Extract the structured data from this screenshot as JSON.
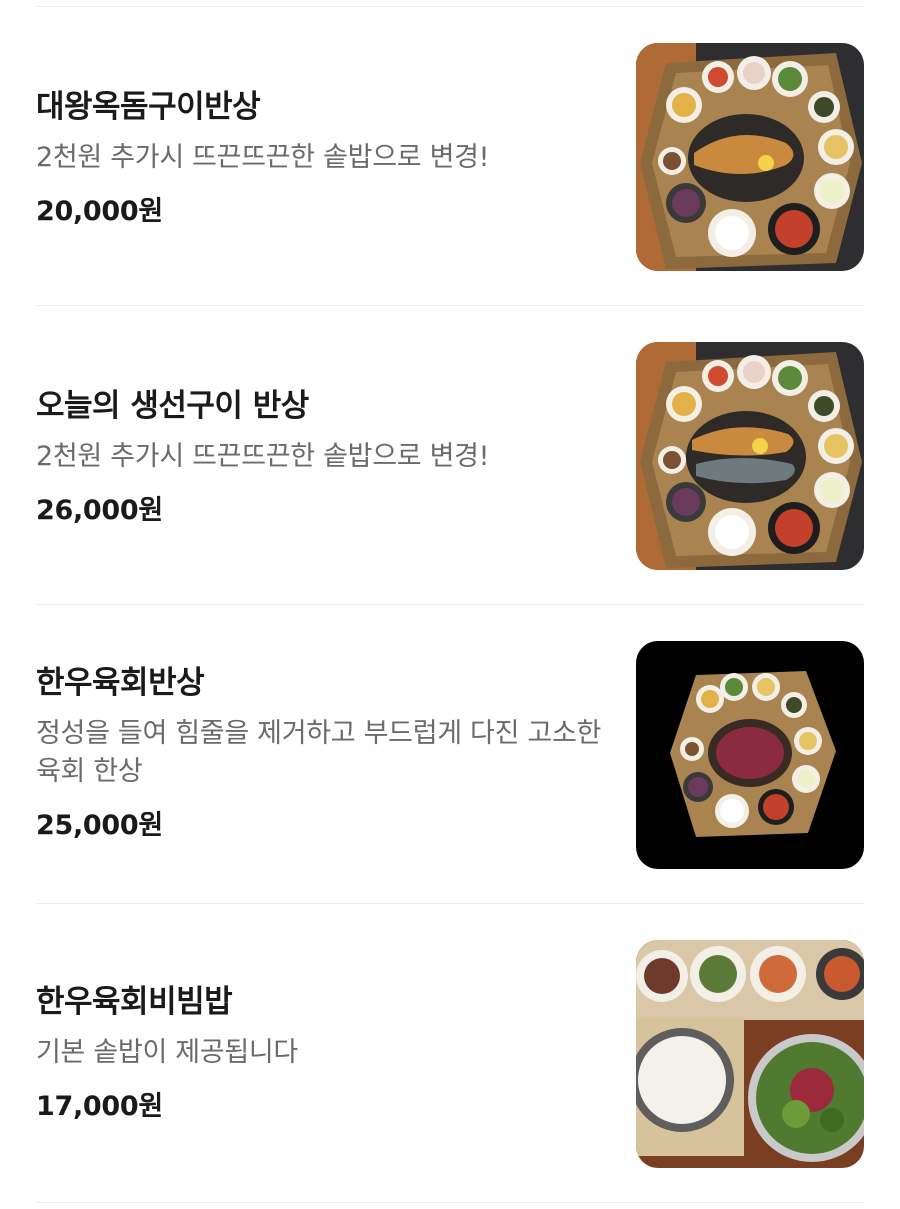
{
  "menu": {
    "items": [
      {
        "name": "대왕옥돔구이반상",
        "description": "2천원 추가시 뜨끈뜨끈한 솥밥으로 변경!",
        "price": "20,000원"
      },
      {
        "name": "오늘의 생선구이 반상",
        "description": "2천원 추가시 뜨끈뜨끈한 솥밥으로 변경!",
        "price": "26,000원"
      },
      {
        "name": "한우육회반상",
        "description": "정성을 들여 힘줄을 제거하고 부드럽게 다진 고소한 육회 한상",
        "price": "25,000원"
      },
      {
        "name": "한우육회비빔밥",
        "description": "기본 솥밥이 제공됩니다",
        "price": "17,000원"
      }
    ]
  }
}
